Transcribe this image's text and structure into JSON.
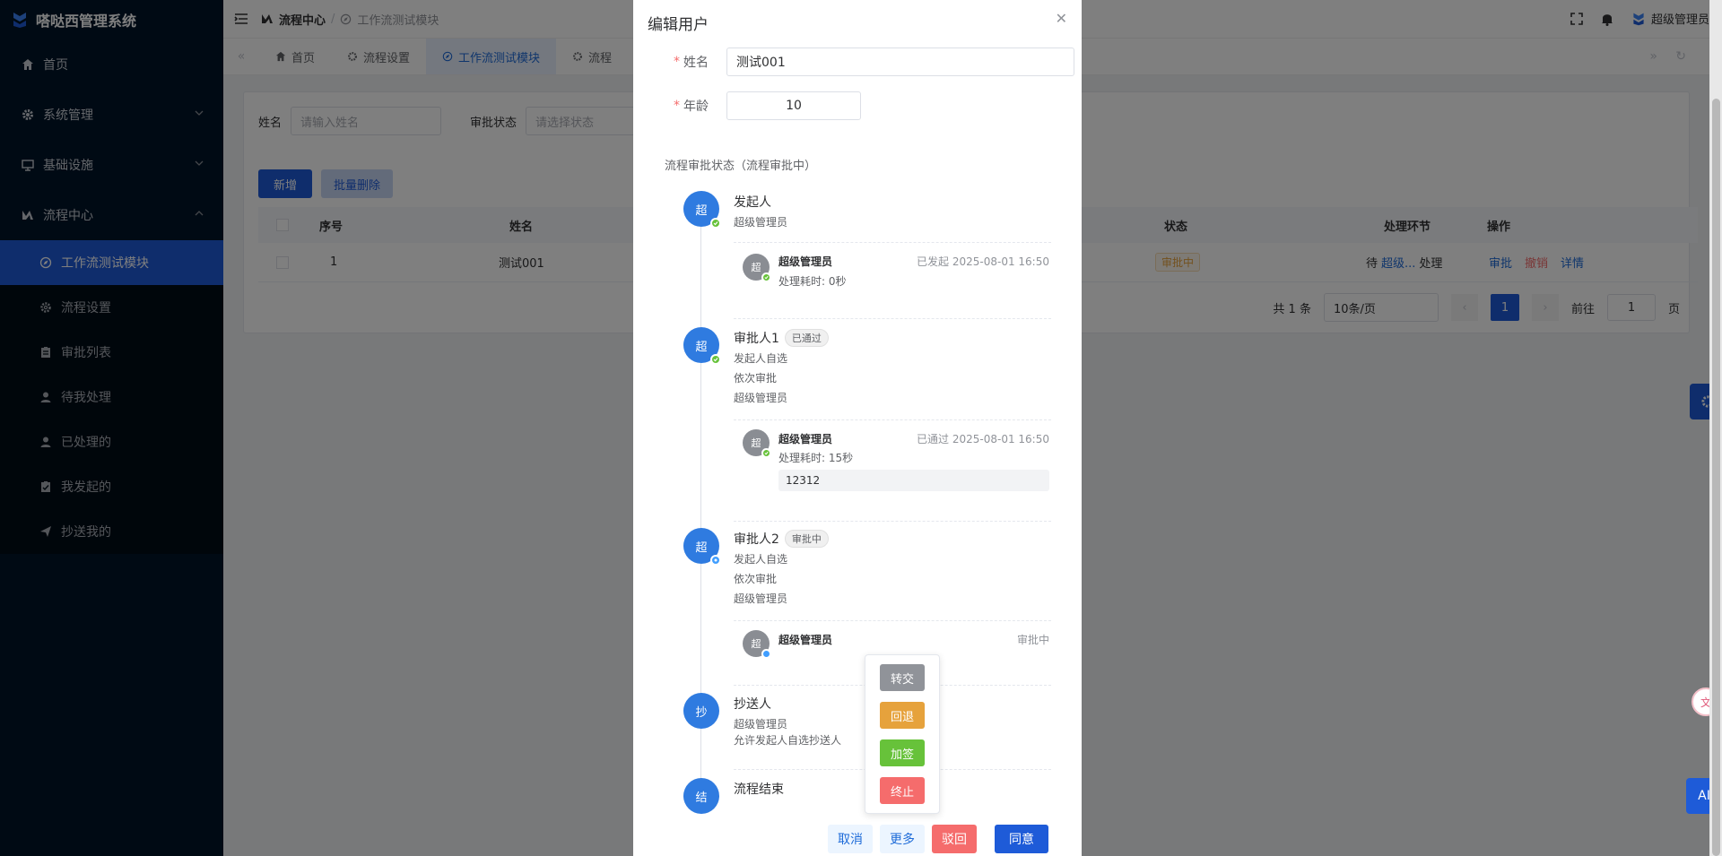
{
  "app": {
    "title": "嗒哒西管理系统"
  },
  "colors": {
    "primary": "#1e5bd8",
    "sidebar_bg": "#001529",
    "success": "#67c23a",
    "warning": "#e6a23c",
    "danger": "#f56c6c",
    "info": "#909399"
  },
  "sidebar": {
    "items": [
      {
        "label": "首页",
        "icon": "home-icon"
      },
      {
        "label": "系统管理",
        "icon": "gear-icon"
      },
      {
        "label": "基础设施",
        "icon": "monitor-icon"
      },
      {
        "label": "流程中心",
        "icon": "flow-icon"
      }
    ],
    "sub_items": [
      {
        "label": "工作流测试模块",
        "icon": "compass-icon",
        "active": true
      },
      {
        "label": "流程设置",
        "icon": "gear-icon"
      },
      {
        "label": "审批列表",
        "icon": "clipboard-icon"
      },
      {
        "label": "待我处理",
        "icon": "user-icon"
      },
      {
        "label": "已处理的",
        "icon": "user-icon"
      },
      {
        "label": "我发起的",
        "icon": "clipboard-check-icon"
      },
      {
        "label": "抄送我的",
        "icon": "send-icon"
      }
    ]
  },
  "header": {
    "breadcrumb": [
      "流程中心",
      "工作流测试模块"
    ],
    "user": "超级管理员"
  },
  "tabs": [
    {
      "label": "首页"
    },
    {
      "label": "流程设置"
    },
    {
      "label": "工作流测试模块",
      "active": true
    },
    {
      "label": "流程"
    }
  ],
  "filters": {
    "name_label": "姓名",
    "name_placeholder": "请输入姓名",
    "status_label": "审批状态",
    "status_placeholder": "请选择状态"
  },
  "toolbar": {
    "add": "新增",
    "batch_delete": "批量删除"
  },
  "table": {
    "columns": [
      "序号",
      "姓名",
      "状态",
      "处理环节",
      "操作"
    ],
    "rows": [
      {
        "index": "1",
        "name": "测试001",
        "status": "审批中",
        "step_prefix": "待",
        "step_user": "超级...",
        "step_suffix": "处理",
        "actions": [
          "审批",
          "撤销",
          "详情"
        ]
      }
    ]
  },
  "pagination": {
    "total": "共 1 条",
    "page_size": "10条/页",
    "current": "1",
    "goto_label": "前往",
    "goto_value": "1",
    "page_unit": "页"
  },
  "modal": {
    "title": "编辑用户",
    "name_label": "姓名",
    "name_value": "测试001",
    "age_label": "年龄",
    "age_value": "10",
    "section_title": "流程审批状态（流程审批中）",
    "nodes": [
      {
        "avatar": "超",
        "title": "发起人",
        "lines": [
          "超级管理员"
        ],
        "record": {
          "avatar": "超",
          "name": "超级管理员",
          "right": "已发起 2025-08-01 16:50",
          "duration": "处理耗时: 0秒"
        }
      },
      {
        "avatar": "超",
        "title": "审批人1",
        "tag": "已通过",
        "lines": [
          "发起人自选",
          "依次审批",
          "超级管理员"
        ],
        "record": {
          "avatar": "超",
          "name": "超级管理员",
          "right": "已通过 2025-08-01 16:50",
          "duration": "处理耗时: 15秒",
          "comment": "12312"
        }
      },
      {
        "avatar": "超",
        "title": "审批人2",
        "tag": "审批中",
        "lines": [
          "发起人自选",
          "依次审批",
          "超级管理员"
        ],
        "record": {
          "avatar": "超",
          "name": "超级管理员",
          "right": "审批中"
        }
      },
      {
        "avatar": "抄",
        "title": "抄送人",
        "lines": [
          "超级管理员",
          "允许发起人自选抄送人"
        ]
      },
      {
        "avatar": "结",
        "title": "流程结束"
      }
    ],
    "more_menu": [
      "转交",
      "回退",
      "加签",
      "终止"
    ],
    "buttons": {
      "cancel": "取消",
      "more": "更多",
      "reject": "驳回",
      "agree": "同意"
    }
  },
  "right_edge": {
    "ai": "AI"
  }
}
